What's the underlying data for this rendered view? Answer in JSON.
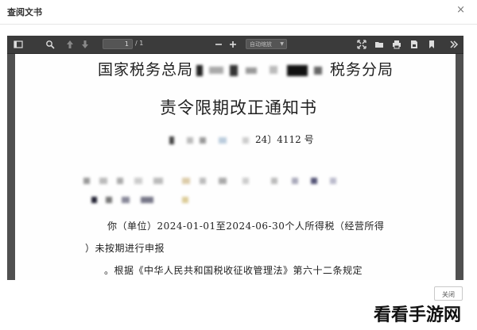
{
  "dialog": {
    "title": "查阅文书",
    "close_glyph": "×",
    "close_button": "关闭"
  },
  "viewer": {
    "page_input": "1",
    "page_count": "/ 1",
    "zoom_value": "自动缩放",
    "icons": [
      "sidebar-toggle-icon",
      "search-icon",
      "previous-page-icon",
      "next-page-icon",
      "zoom-out-icon",
      "zoom-in-icon",
      "presentation-mode-icon",
      "open-file-icon",
      "print-icon",
      "download-icon",
      "bookmark-icon",
      "tools-icon"
    ]
  },
  "document": {
    "header_left": "国家税务总局",
    "header_right": "税务分局",
    "heading": "责令限期改正通知书",
    "doc_number": "24〕4112 号",
    "body_line1": "你（单位）2024-01-01至2024-06-30个人所得税（经营所得",
    "body_line2": "）未按期进行申报",
    "body_line3": "。根据《中华人民共和国税收征收管理法》第六十二条规定"
  },
  "watermark": "看看手游网"
}
